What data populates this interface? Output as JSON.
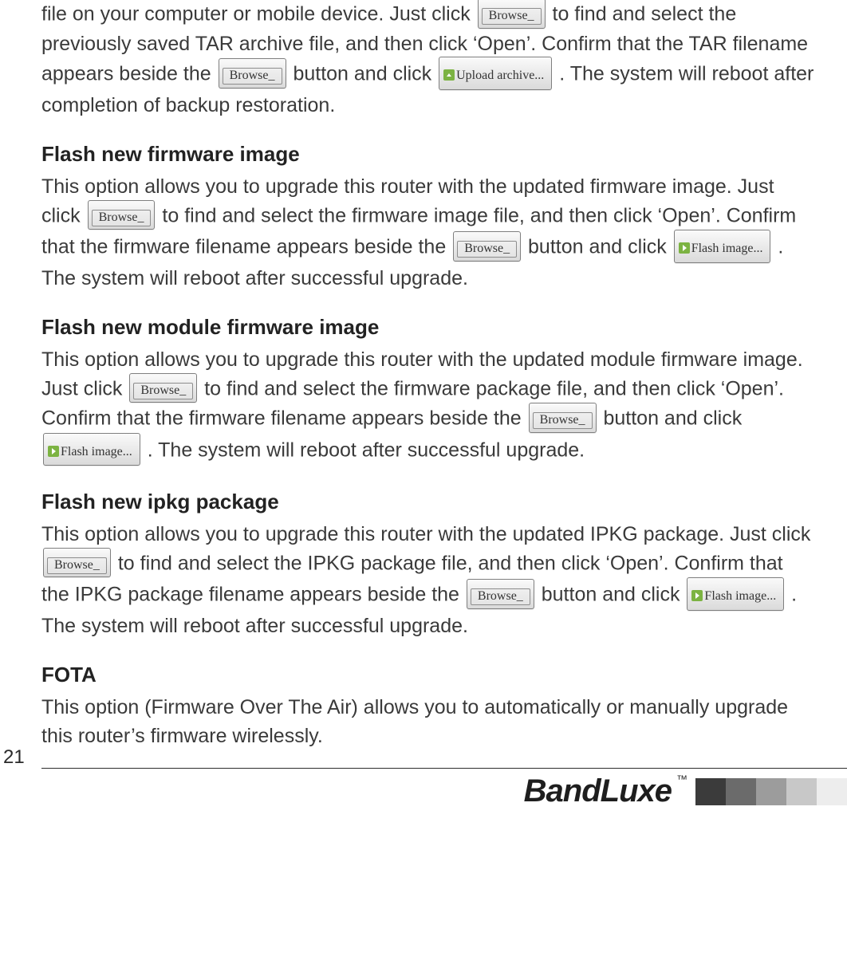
{
  "buttons": {
    "browse": "Browse_",
    "upload_archive": "Upload archive...",
    "flash_image": "Flash image..."
  },
  "intro_para": {
    "line1a": "file on your computer or mobile device. Just click ",
    "line1b": " to find and select the previously saved TAR archive file, and then click ‘Open’. Confirm that the TAR filename appears beside the ",
    "line1c": " button and click ",
    "line1d": ". The system will reboot after completion of backup restoration."
  },
  "sec1": {
    "heading": "Flash new firmware image",
    "t1": "This option allows you to upgrade this router with the updated firmware image. Just click ",
    "t2": " to find and select the firmware image file, and then click ‘Open’. Confirm that the firmware filename appears beside the ",
    "t3": " button and click ",
    "t4": ". The system will reboot after successful upgrade."
  },
  "sec2": {
    "heading": "Flash new module firmware image",
    "t1": "This option allows you to upgrade this router with the updated module firmware image. Just click ",
    "t2": " to find and select the firmware package file, and then click ‘Open’. Confirm that the firmware filename appears beside the ",
    "t3": " button and click ",
    "t4": ". The system will reboot after successful upgrade."
  },
  "sec3": {
    "heading": "Flash new ipkg package",
    "t1": "This option allows you to upgrade this router with the updated IPKG package. Just click ",
    "t2": " to find and select the IPKG package file, and then click ‘Open’. Confirm that the IPKG package filename appears beside the ",
    "t3": " button and click ",
    "t4": ". The system will reboot after successful upgrade."
  },
  "sec4": {
    "heading": "FOTA",
    "t1": "This option (Firmware Over The Air) allows you to automatically or manually upgrade this router’s firmware wirelessly."
  },
  "footer": {
    "page_number": "21",
    "brand": "BandLuxe",
    "tm": "™"
  },
  "fade_colors": [
    "#3b3b3b",
    "#6b6b6b",
    "#9c9c9c",
    "#c8c8c8",
    "#ededed"
  ]
}
